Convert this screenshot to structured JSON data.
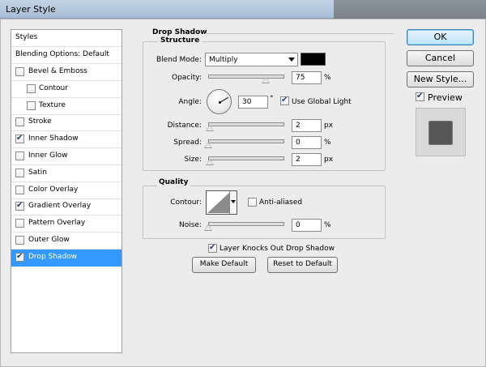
{
  "window": {
    "title": "Layer Style"
  },
  "styles_list": {
    "header": "Styles",
    "blending_options": "Blending Options: Default",
    "items": [
      {
        "label": "Bevel & Emboss",
        "checked": false,
        "indent": false,
        "selected": false
      },
      {
        "label": "Contour",
        "checked": false,
        "indent": true,
        "selected": false
      },
      {
        "label": "Texture",
        "checked": false,
        "indent": true,
        "selected": false
      },
      {
        "label": "Stroke",
        "checked": false,
        "indent": false,
        "selected": false
      },
      {
        "label": "Inner Shadow",
        "checked": true,
        "indent": false,
        "selected": false
      },
      {
        "label": "Inner Glow",
        "checked": false,
        "indent": false,
        "selected": false
      },
      {
        "label": "Satin",
        "checked": false,
        "indent": false,
        "selected": false
      },
      {
        "label": "Color Overlay",
        "checked": false,
        "indent": false,
        "selected": false
      },
      {
        "label": "Gradient Overlay",
        "checked": true,
        "indent": false,
        "selected": false
      },
      {
        "label": "Pattern Overlay",
        "checked": false,
        "indent": false,
        "selected": false
      },
      {
        "label": "Outer Glow",
        "checked": false,
        "indent": false,
        "selected": false
      },
      {
        "label": "Drop Shadow",
        "checked": true,
        "indent": false,
        "selected": true
      }
    ]
  },
  "drop_shadow": {
    "title": "Drop Shadow",
    "structure": {
      "title": "Structure",
      "blend_mode_label": "Blend Mode:",
      "blend_mode_value": "Multiply",
      "shadow_color": "#000000",
      "opacity_label": "Opacity:",
      "opacity_value": "75",
      "opacity_slider": 0.75,
      "opacity_unit": "%",
      "angle_label": "Angle:",
      "angle_value": "30",
      "angle_unit": "°",
      "use_global_light_label": "Use Global Light",
      "use_global_light": true,
      "distance_label": "Distance:",
      "distance_value": "2",
      "distance_unit": "px",
      "spread_label": "Spread:",
      "spread_value": "0",
      "spread_unit": "%",
      "size_label": "Size:",
      "size_value": "2",
      "size_unit": "px"
    },
    "quality": {
      "title": "Quality",
      "contour_label": "Contour:",
      "anti_aliased_label": "Anti-aliased",
      "anti_aliased": false,
      "noise_label": "Noise:",
      "noise_value": "0",
      "noise_unit": "%"
    },
    "knocks_out_label": "Layer Knocks Out Drop Shadow",
    "knocks_out": true,
    "make_default_label": "Make Default",
    "reset_default_label": "Reset to Default"
  },
  "actions": {
    "ok_label": "OK",
    "cancel_label": "Cancel",
    "new_style_label": "New Style...",
    "preview_label": "Preview",
    "preview_checked": true
  }
}
